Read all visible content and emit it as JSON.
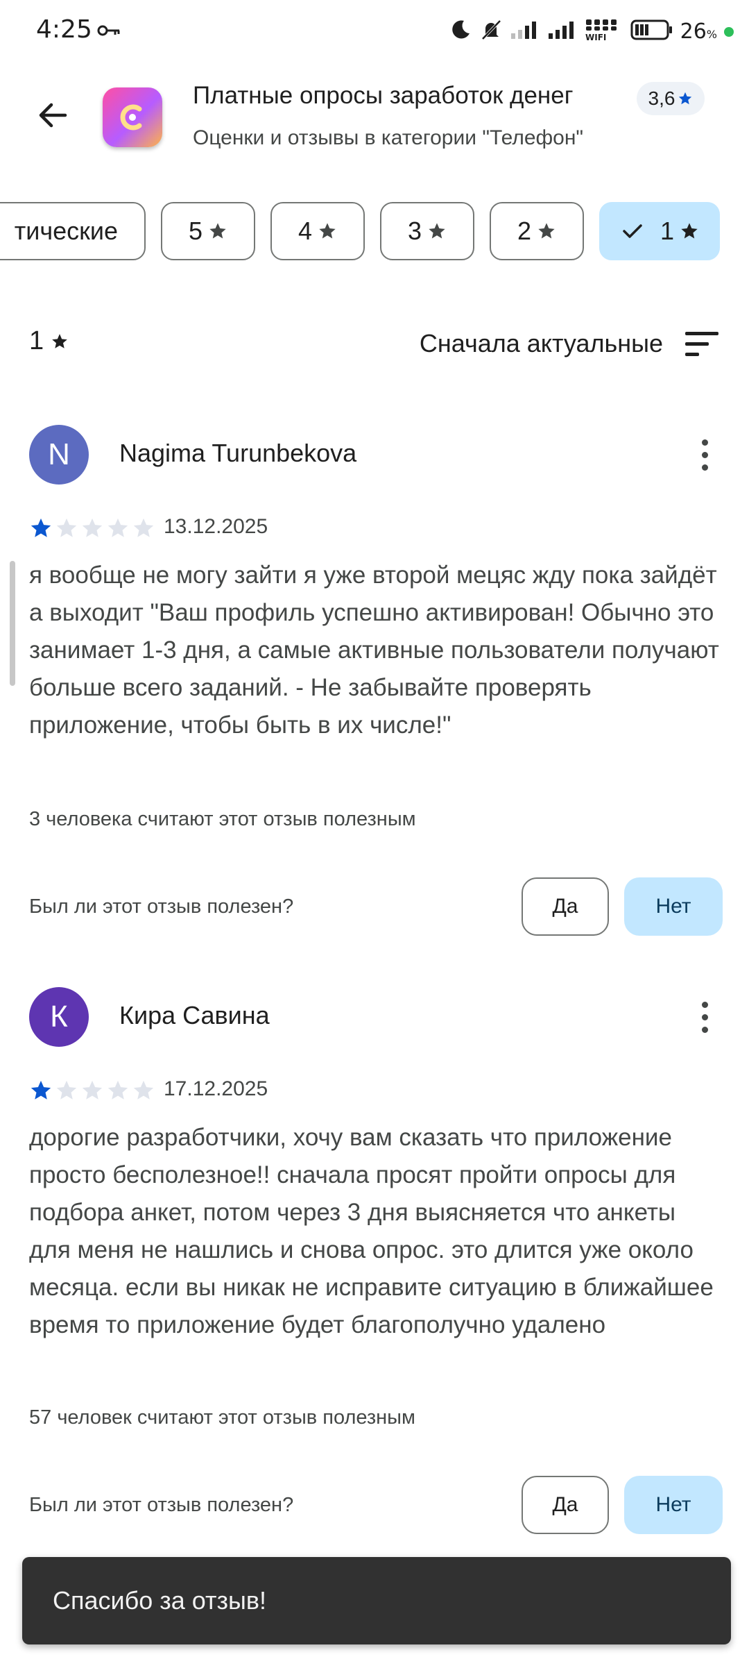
{
  "status_bar": {
    "time": "4:25",
    "battery_percent": "26",
    "battery_unit": "%",
    "wifi_label": "WIFI"
  },
  "header": {
    "title": "Платные опросы заработок денег",
    "subtitle": "Оценки и отзывы в категории \"Телефон\"",
    "rating": "3,6"
  },
  "filters": [
    {
      "label": "тические",
      "selected": false
    },
    {
      "label": "5",
      "selected": false
    },
    {
      "label": "4",
      "selected": false
    },
    {
      "label": "3",
      "selected": false
    },
    {
      "label": "2",
      "selected": false
    },
    {
      "label": "1",
      "selected": true
    }
  ],
  "section": {
    "rating_value": "1",
    "sort_label": "Сначала актуальные"
  },
  "reviews": [
    {
      "initial": "N",
      "avatar_color": "#5c6bc0",
      "author": "Nagima Turunbekova",
      "stars": 1,
      "date": "13.12.2025",
      "text": "я вообще не могу зайти я уже второй мецяс жду пока зайдёт а выходит \"Ваш профиль успешно активирован! Обычно это занимает 1-3 дня, а самые активные пользователи получают больше всего заданий. - Не забывайте проверять приложение, чтобы быть в их числе!\"",
      "helpful_count": "3 человека считают этот отзыв полезным",
      "helpful_question": "Был ли этот отзыв полезен?",
      "yes_label": "Да",
      "no_label": "Нет"
    },
    {
      "initial": "К",
      "avatar_color": "#5e35b1",
      "author": "Кира Савина",
      "stars": 1,
      "date": "17.12.2025",
      "text": "дорогие разработчики, хочу вам сказать что приложение просто бесполезное!! сначала просят пройти опросы для подбора анкет, потом через 3 дня выясняется что анкеты для меня не нашлись и снова опрос. это длится уже около месяца. если вы никак не исправите ситуацию в ближайшее время то приложение будет благополучно удалено",
      "helpful_count": "57 человек считают этот отзыв полезным",
      "helpful_question": "Был ли этот отзыв полезен?",
      "yes_label": "Да",
      "no_label": "Нет"
    }
  ],
  "snackbar": {
    "message": "Спасибо за отзыв!"
  },
  "colors": {
    "star_filled": "#0b57d0",
    "star_empty": "#dfe3eb",
    "chip_selected": "#c2e7ff"
  }
}
